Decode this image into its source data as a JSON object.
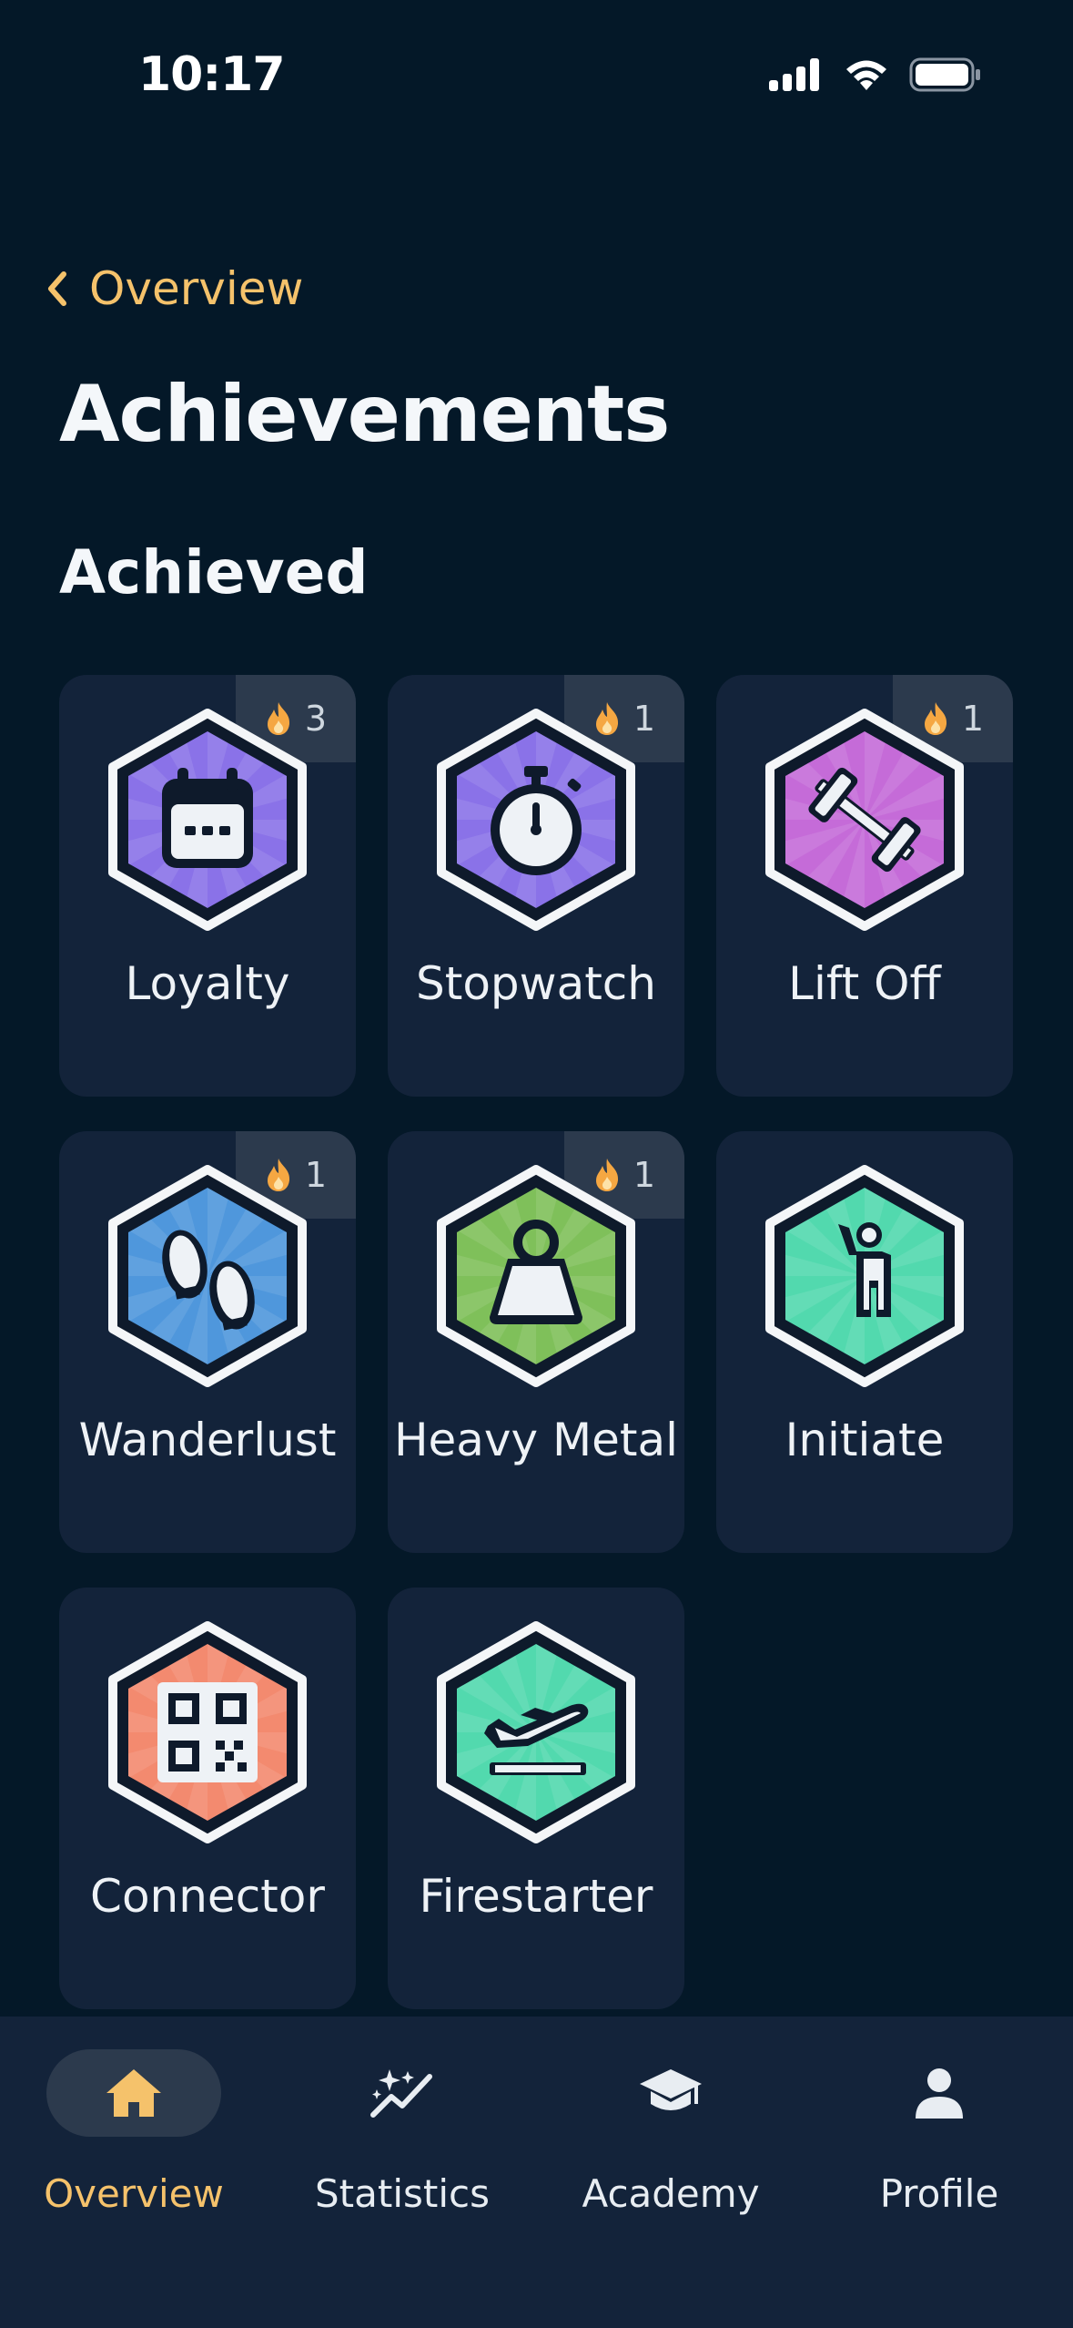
{
  "status_bar": {
    "time": "10:17",
    "icons": [
      "signal-icon",
      "wifi-icon",
      "battery-icon"
    ]
  },
  "nav": {
    "back_label": "Overview",
    "back_icon": "chevron-left-icon"
  },
  "page": {
    "title": "Achievements",
    "section_title": "Achieved"
  },
  "achievements": [
    {
      "name": "Loyalty",
      "icon": "calendar-icon",
      "streak": "3",
      "color": "#8a72e8"
    },
    {
      "name": "Stopwatch",
      "icon": "stopwatch-icon",
      "streak": "1",
      "color": "#8a72e8"
    },
    {
      "name": "Lift Off",
      "icon": "barbell-icon",
      "streak": "1",
      "color": "#c56bd8"
    },
    {
      "name": "Wanderlust",
      "icon": "footprints-icon",
      "streak": "1",
      "color": "#4f97dc"
    },
    {
      "name": "Heavy Metal",
      "icon": "kettlebell-icon",
      "streak": "1",
      "color": "#7fc05a"
    },
    {
      "name": "Initiate",
      "icon": "person-wave-icon",
      "streak": "",
      "color": "#52d9ae"
    },
    {
      "name": "Connector",
      "icon": "qr-code-icon",
      "streak": "",
      "color": "#f38a6f"
    },
    {
      "name": "Firestarter",
      "icon": "plane-takeoff-icon",
      "streak": "",
      "color": "#52d9ae"
    }
  ],
  "tabs": [
    {
      "label": "Overview",
      "icon": "home-icon",
      "active": true
    },
    {
      "label": "Statistics",
      "icon": "sparkles-chart-icon",
      "active": false
    },
    {
      "label": "Academy",
      "icon": "graduation-cap-icon",
      "active": false
    },
    {
      "label": "Profile",
      "icon": "person-icon",
      "active": false
    }
  ],
  "colors": {
    "background": "#041828",
    "card": "#13233a",
    "accent": "#f5c26b",
    "flame": "#f5a742"
  }
}
